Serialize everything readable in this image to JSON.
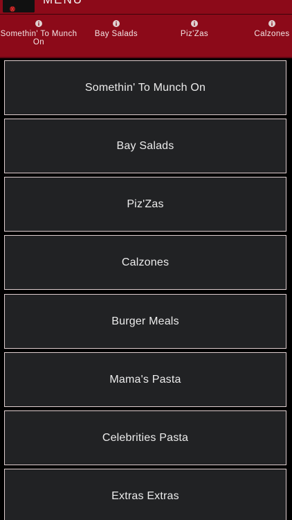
{
  "header": {
    "title": "MENU"
  },
  "tabs": [
    {
      "label": "Somethin' To Munch On",
      "icon": "info-icon"
    },
    {
      "label": "Bay Salads",
      "icon": "info-icon"
    },
    {
      "label": "Piz'Zas",
      "icon": "info-icon"
    },
    {
      "label": "Calzones",
      "icon": "info-icon"
    }
  ],
  "menu": {
    "items": [
      {
        "label": "Somethin' To Munch On"
      },
      {
        "label": "Bay Salads"
      },
      {
        "label": "Piz'Zas"
      },
      {
        "label": "Calzones"
      },
      {
        "label": "Burger Meals"
      },
      {
        "label": "Mama's Pasta"
      },
      {
        "label": "Celebrities Pasta"
      },
      {
        "label": "Extras Extras"
      }
    ]
  },
  "colors": {
    "header_background": "#8c0a19",
    "item_background": "#212224",
    "item_border": "#e0cfd0",
    "page_background": "#000000"
  }
}
